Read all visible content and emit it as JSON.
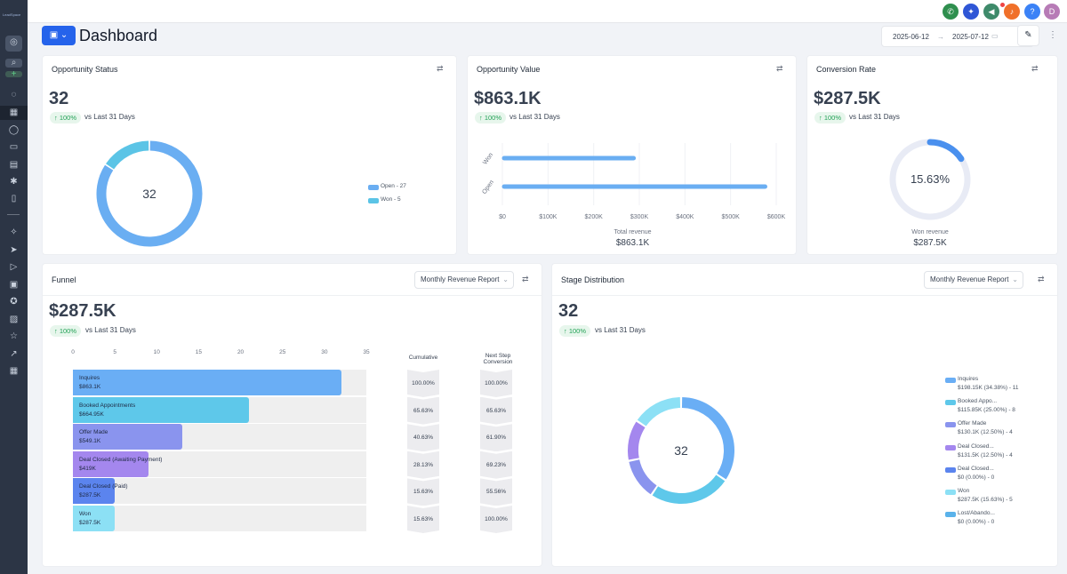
{
  "app": {
    "logo_text": "LeadSpace"
  },
  "sidebar": {
    "items": [
      {
        "icon": "user-icon"
      },
      {
        "icon": "search-icon"
      },
      {
        "icon": "plus-icon"
      },
      {
        "icon": "rocket-icon"
      },
      {
        "icon": "dashboard-icon",
        "active": true
      },
      {
        "icon": "chat-icon"
      },
      {
        "icon": "calendar-icon"
      },
      {
        "icon": "contacts-icon"
      },
      {
        "icon": "network-icon"
      },
      {
        "icon": "payments-icon"
      },
      {
        "icon": "sparkle-icon"
      },
      {
        "icon": "send-icon"
      },
      {
        "icon": "play-icon"
      },
      {
        "icon": "site-icon"
      },
      {
        "icon": "badge-icon"
      },
      {
        "icon": "media-icon"
      },
      {
        "icon": "star-icon"
      },
      {
        "icon": "trend-icon"
      },
      {
        "icon": "apps-icon"
      }
    ]
  },
  "topbar": {
    "buttons": [
      {
        "icon": "phone-icon",
        "color": "#2f8f4e"
      },
      {
        "icon": "magic-icon",
        "color": "#2f56d6"
      },
      {
        "icon": "megaphone-icon",
        "color": "#3e8a6a"
      },
      {
        "icon": "bell-icon",
        "color": "#f0702a"
      },
      {
        "icon": "help-icon",
        "label": "?",
        "color": "#3b82f6"
      },
      {
        "icon": "avatar",
        "label": "D",
        "color": "#b77bb6"
      }
    ]
  },
  "header": {
    "title": "Dashboard",
    "date_start": "2025-06-12",
    "date_end": "2025-07-12",
    "arrow": "→"
  },
  "colors": {
    "accent": "#2563eb",
    "up": "#22a155"
  },
  "opportunity_status": {
    "title": "Opportunity Status",
    "value": "32",
    "change": "↑ 100%",
    "compare": "vs Last 31 Days",
    "center": "32",
    "legend": [
      {
        "label": "Open - 27",
        "count": 27,
        "color": "#6aaef2"
      },
      {
        "label": "Won - 5",
        "count": 5,
        "color": "#5bc4e6"
      }
    ]
  },
  "opportunity_value": {
    "title": "Opportunity Value",
    "value": "$863.1K",
    "change": "↑ 100%",
    "compare": "vs Last 31 Days",
    "categories": [
      "Won",
      "Open"
    ],
    "values": [
      287500,
      575600
    ],
    "ticks": [
      "$0",
      "$100K",
      "$200K",
      "$300K",
      "$400K",
      "$500K",
      "$600K"
    ],
    "xmax": 600000,
    "total_label": "Total revenue",
    "total": "$863.1K"
  },
  "conversion_rate": {
    "title": "Conversion Rate",
    "value": "$287.5K",
    "change": "↑ 100%",
    "compare": "vs Last 31 Days",
    "percent": 15.63,
    "percent_label": "15.63%",
    "sub_label": "Won revenue",
    "sub_value": "$287.5K"
  },
  "funnel": {
    "title": "Funnel",
    "select": "Monthly Revenue Report",
    "value": "$287.5K",
    "change": "↑ 100%",
    "compare": "vs Last 31 Days",
    "ticks": [
      "0",
      "5",
      "10",
      "15",
      "20",
      "25",
      "30",
      "35"
    ],
    "xmax": 35,
    "col_cumulative": "Cumulative",
    "col_next": "Next Step Conversion",
    "stages": [
      {
        "name": "Inquires",
        "amount": "$863.1K",
        "count": 32,
        "color": "#6aaef5",
        "cumulative": "100.00%",
        "next": "100.00%"
      },
      {
        "name": "Booked Appointments",
        "amount": "$664.95K",
        "count": 21,
        "color": "#5ec8ea",
        "cumulative": "65.63%",
        "next": "65.63%"
      },
      {
        "name": "Offer Made",
        "amount": "$549.1K",
        "count": 13,
        "color": "#8a94ee",
        "cumulative": "40.63%",
        "next": "61.90%"
      },
      {
        "name": "Deal Closed (Awaiting Payment)",
        "amount": "$419K",
        "count": 9,
        "color": "#a487ee",
        "cumulative": "28.13%",
        "next": "69.23%"
      },
      {
        "name": "Deal Closed (Paid)",
        "amount": "$287.5K",
        "count": 5,
        "color": "#5b84ee",
        "cumulative": "15.63%",
        "next": "55.56%"
      },
      {
        "name": "Won",
        "amount": "$287.5K",
        "count": 5,
        "color": "#8ce0f5",
        "cumulative": "15.63%",
        "next": "100.00%"
      }
    ]
  },
  "stage_distribution": {
    "title": "Stage Distribution",
    "select": "Monthly Revenue Report",
    "value": "32",
    "change": "↑ 100%",
    "compare": "vs Last 31 Days",
    "center": "32",
    "legend": [
      {
        "name": "Inquires",
        "detail": "$198.15K (34.38%) - 11",
        "count": 11,
        "color": "#6aaef5"
      },
      {
        "name": "Booked Appo...",
        "detail": "$115.85K (25.00%) - 8",
        "count": 8,
        "color": "#5ec8ea"
      },
      {
        "name": "Offer Made",
        "detail": "$130.1K (12.50%) - 4",
        "count": 4,
        "color": "#8a94ee"
      },
      {
        "name": "Deal Closed...",
        "detail": "$131.5K (12.50%) - 4",
        "count": 4,
        "color": "#a487ee"
      },
      {
        "name": "Deal Closed...",
        "detail": "$0 (0.00%) - 0",
        "count": 0,
        "color": "#5b84ee"
      },
      {
        "name": "Won",
        "detail": "$287.5K (15.63%) - 5",
        "count": 5,
        "color": "#8ce0f5"
      },
      {
        "name": "Lost/Abando...",
        "detail": "$0 (0.00%) - 0",
        "count": 0,
        "color": "#5ab2ea"
      }
    ]
  }
}
